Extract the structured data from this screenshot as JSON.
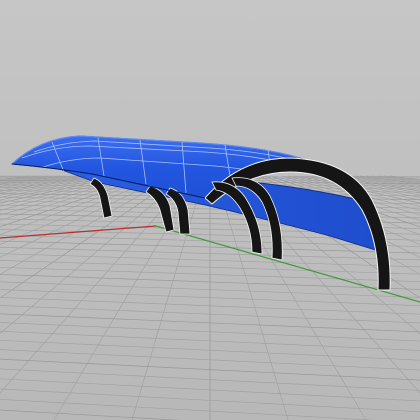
{
  "viewport": {
    "view": "perspective",
    "background_color": "#b4b4b4",
    "grid_color": "#a2a2a2",
    "grid_major_color": "#989898",
    "x_axis_color": "#b3312e",
    "y_axis_color": "#3f9b3a"
  },
  "model": {
    "object": "canopy-structure",
    "roof_color": "#2357e0",
    "roof_highlight_color": "#5d8af4",
    "glazing_line_color": "#a8c1ff",
    "arch_color": "#151515",
    "arch_edge_color": "#ffffff"
  }
}
